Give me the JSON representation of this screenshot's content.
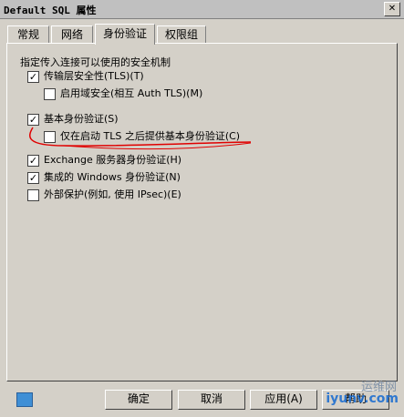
{
  "window": {
    "title": "Default SQL 属性"
  },
  "tabs": [
    {
      "label": "常规"
    },
    {
      "label": "网络"
    },
    {
      "label": "身份验证"
    },
    {
      "label": "权限组"
    }
  ],
  "heading": "指定传入连接可以使用的安全机制",
  "options": [
    {
      "label": "传输层安全性(TLS)(T)",
      "checked": true
    },
    {
      "label": "启用域安全(相互 Auth TLS)(M)",
      "checked": false
    },
    {
      "label": "基本身份验证(S)",
      "checked": true
    },
    {
      "label": "仅在启动 TLS 之后提供基本身份验证(C)",
      "checked": false
    },
    {
      "label": "Exchange 服务器身份验证(H)",
      "checked": true
    },
    {
      "label": "集成的 Windows 身份验证(N)",
      "checked": true
    },
    {
      "label": "外部保护(例如, 使用 IPsec)(E)",
      "checked": false
    }
  ],
  "buttons": {
    "ok": "确定",
    "cancel": "取消",
    "apply": "应用(A)",
    "help": "帮助"
  },
  "watermark": {
    "line1": "运维网",
    "line2": "iyunv.com"
  }
}
